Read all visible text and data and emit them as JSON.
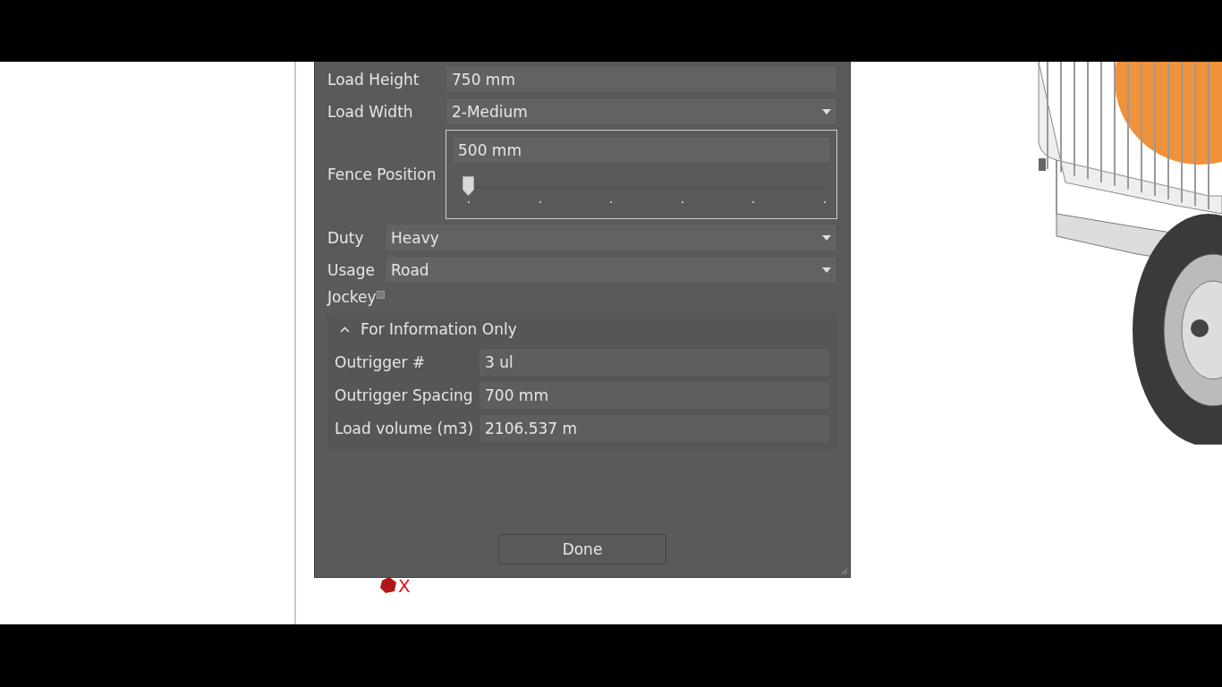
{
  "dialog": {
    "form_groups": [
      [
        {
          "kind": "text",
          "label": "Load Height",
          "value": "750 mm"
        },
        {
          "kind": "dropdown",
          "label": "Load Width",
          "value": "2-Medium"
        },
        {
          "kind": "slider",
          "label": "Fence Position",
          "value": "500 mm",
          "level": 0
        }
      ],
      [
        {
          "kind": "dropdown",
          "label": "Duty",
          "value": "Heavy"
        },
        {
          "kind": "dropdown",
          "label": "Usage",
          "value": "Road"
        },
        {
          "kind": "checkbox",
          "label": "Jockey",
          "checked": false
        }
      ]
    ],
    "section": {
      "title": "For Information Only",
      "expanded": true,
      "fields": [
        {
          "label": "Outrigger #",
          "value": "3 ul"
        },
        {
          "label": "Outrigger Spacing",
          "value": "700 mm"
        },
        {
          "label": "Load volume (m3)",
          "value": "2106.537 m"
        }
      ]
    },
    "button": "Done"
  },
  "viewport": {
    "axis_label": "X"
  }
}
